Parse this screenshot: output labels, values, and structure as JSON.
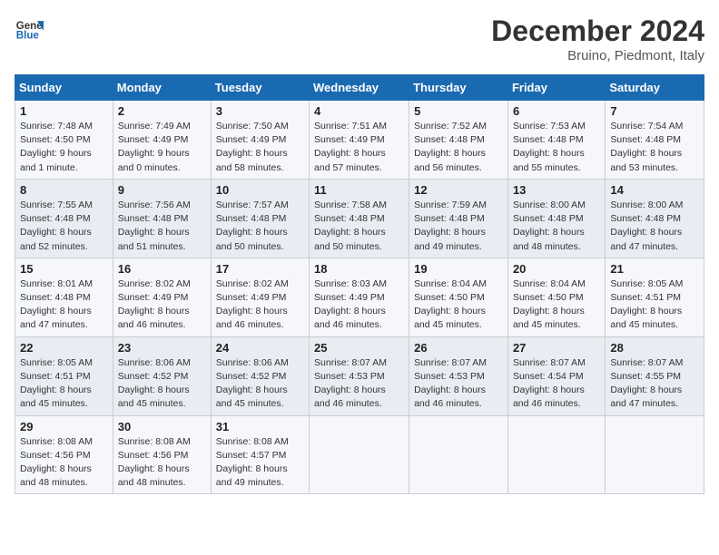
{
  "header": {
    "logo_line1": "General",
    "logo_line2": "Blue",
    "title": "December 2024",
    "subtitle": "Bruino, Piedmont, Italy"
  },
  "weekdays": [
    "Sunday",
    "Monday",
    "Tuesday",
    "Wednesday",
    "Thursday",
    "Friday",
    "Saturday"
  ],
  "weeks": [
    [
      {
        "day": "1",
        "sunrise": "7:48 AM",
        "sunset": "4:50 PM",
        "daylight": "9 hours and 1 minute."
      },
      {
        "day": "2",
        "sunrise": "7:49 AM",
        "sunset": "4:49 PM",
        "daylight": "9 hours and 0 minutes."
      },
      {
        "day": "3",
        "sunrise": "7:50 AM",
        "sunset": "4:49 PM",
        "daylight": "8 hours and 58 minutes."
      },
      {
        "day": "4",
        "sunrise": "7:51 AM",
        "sunset": "4:49 PM",
        "daylight": "8 hours and 57 minutes."
      },
      {
        "day": "5",
        "sunrise": "7:52 AM",
        "sunset": "4:48 PM",
        "daylight": "8 hours and 56 minutes."
      },
      {
        "day": "6",
        "sunrise": "7:53 AM",
        "sunset": "4:48 PM",
        "daylight": "8 hours and 55 minutes."
      },
      {
        "day": "7",
        "sunrise": "7:54 AM",
        "sunset": "4:48 PM",
        "daylight": "8 hours and 53 minutes."
      }
    ],
    [
      {
        "day": "8",
        "sunrise": "7:55 AM",
        "sunset": "4:48 PM",
        "daylight": "8 hours and 52 minutes."
      },
      {
        "day": "9",
        "sunrise": "7:56 AM",
        "sunset": "4:48 PM",
        "daylight": "8 hours and 51 minutes."
      },
      {
        "day": "10",
        "sunrise": "7:57 AM",
        "sunset": "4:48 PM",
        "daylight": "8 hours and 50 minutes."
      },
      {
        "day": "11",
        "sunrise": "7:58 AM",
        "sunset": "4:48 PM",
        "daylight": "8 hours and 50 minutes."
      },
      {
        "day": "12",
        "sunrise": "7:59 AM",
        "sunset": "4:48 PM",
        "daylight": "8 hours and 49 minutes."
      },
      {
        "day": "13",
        "sunrise": "8:00 AM",
        "sunset": "4:48 PM",
        "daylight": "8 hours and 48 minutes."
      },
      {
        "day": "14",
        "sunrise": "8:00 AM",
        "sunset": "4:48 PM",
        "daylight": "8 hours and 47 minutes."
      }
    ],
    [
      {
        "day": "15",
        "sunrise": "8:01 AM",
        "sunset": "4:48 PM",
        "daylight": "8 hours and 47 minutes."
      },
      {
        "day": "16",
        "sunrise": "8:02 AM",
        "sunset": "4:49 PM",
        "daylight": "8 hours and 46 minutes."
      },
      {
        "day": "17",
        "sunrise": "8:02 AM",
        "sunset": "4:49 PM",
        "daylight": "8 hours and 46 minutes."
      },
      {
        "day": "18",
        "sunrise": "8:03 AM",
        "sunset": "4:49 PM",
        "daylight": "8 hours and 46 minutes."
      },
      {
        "day": "19",
        "sunrise": "8:04 AM",
        "sunset": "4:50 PM",
        "daylight": "8 hours and 45 minutes."
      },
      {
        "day": "20",
        "sunrise": "8:04 AM",
        "sunset": "4:50 PM",
        "daylight": "8 hours and 45 minutes."
      },
      {
        "day": "21",
        "sunrise": "8:05 AM",
        "sunset": "4:51 PM",
        "daylight": "8 hours and 45 minutes."
      }
    ],
    [
      {
        "day": "22",
        "sunrise": "8:05 AM",
        "sunset": "4:51 PM",
        "daylight": "8 hours and 45 minutes."
      },
      {
        "day": "23",
        "sunrise": "8:06 AM",
        "sunset": "4:52 PM",
        "daylight": "8 hours and 45 minutes."
      },
      {
        "day": "24",
        "sunrise": "8:06 AM",
        "sunset": "4:52 PM",
        "daylight": "8 hours and 45 minutes."
      },
      {
        "day": "25",
        "sunrise": "8:07 AM",
        "sunset": "4:53 PM",
        "daylight": "8 hours and 46 minutes."
      },
      {
        "day": "26",
        "sunrise": "8:07 AM",
        "sunset": "4:53 PM",
        "daylight": "8 hours and 46 minutes."
      },
      {
        "day": "27",
        "sunrise": "8:07 AM",
        "sunset": "4:54 PM",
        "daylight": "8 hours and 46 minutes."
      },
      {
        "day": "28",
        "sunrise": "8:07 AM",
        "sunset": "4:55 PM",
        "daylight": "8 hours and 47 minutes."
      }
    ],
    [
      {
        "day": "29",
        "sunrise": "8:08 AM",
        "sunset": "4:56 PM",
        "daylight": "8 hours and 48 minutes."
      },
      {
        "day": "30",
        "sunrise": "8:08 AM",
        "sunset": "4:56 PM",
        "daylight": "8 hours and 48 minutes."
      },
      {
        "day": "31",
        "sunrise": "8:08 AM",
        "sunset": "4:57 PM",
        "daylight": "8 hours and 49 minutes."
      },
      null,
      null,
      null,
      null
    ]
  ]
}
